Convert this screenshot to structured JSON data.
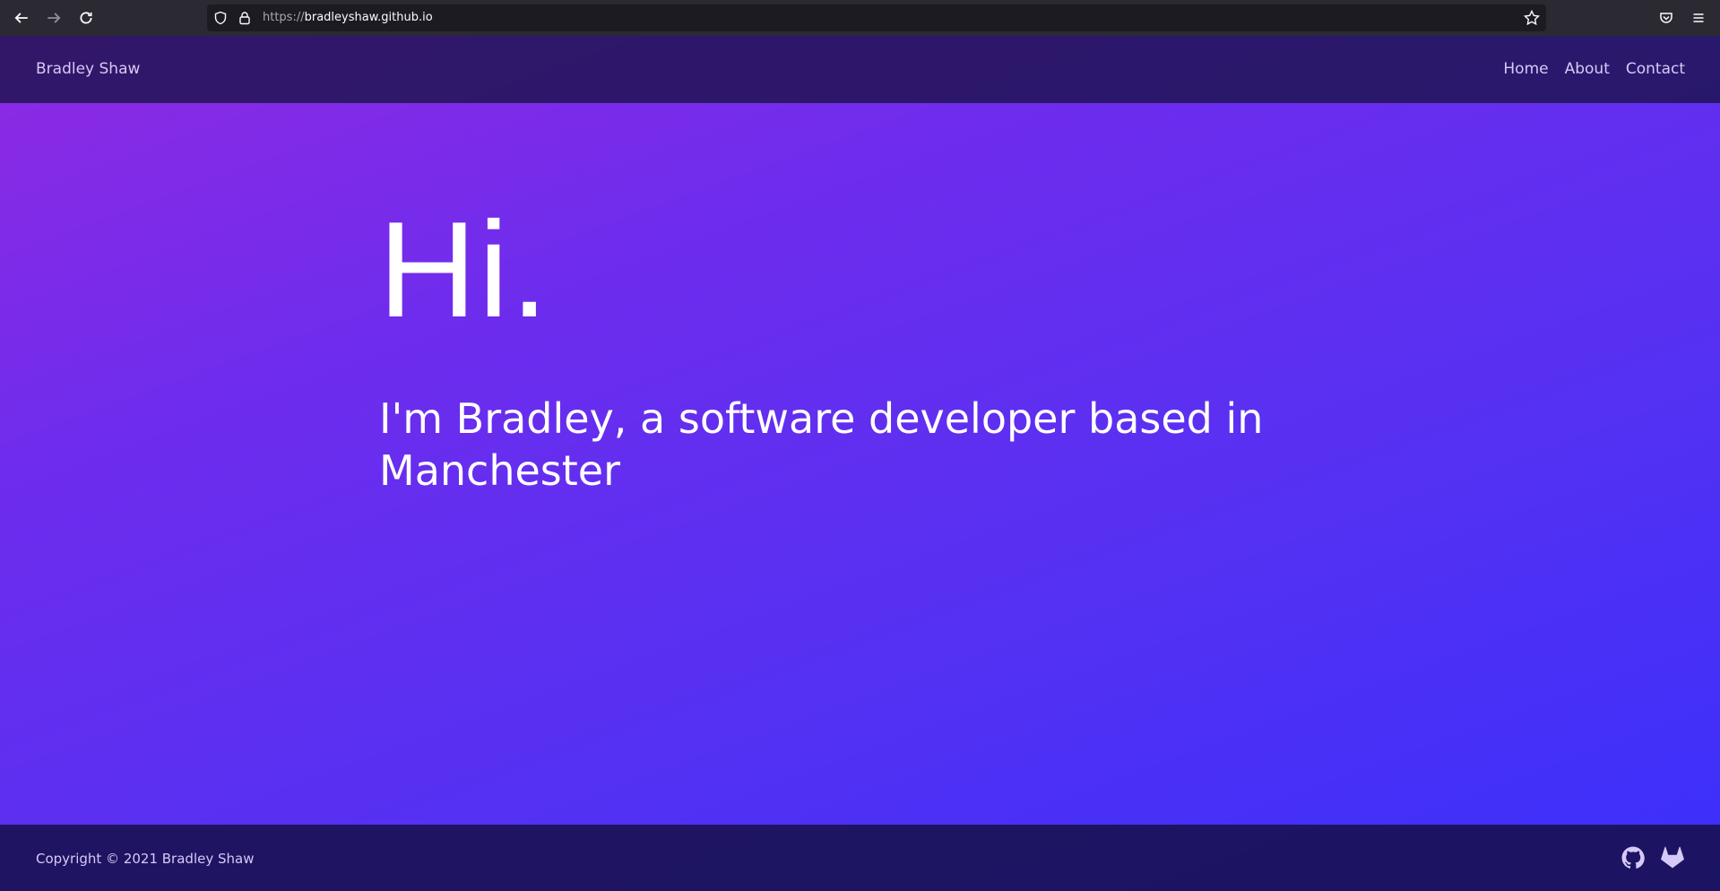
{
  "browser": {
    "url_protocol": "https://",
    "url_host": "bradleyshaw.github.io",
    "back_icon": "back-arrow-icon",
    "forward_icon": "forward-arrow-icon",
    "reload_icon": "reload-icon",
    "shield_icon": "tracking-shield-icon",
    "lock_icon": "lock-icon",
    "bookmark_icon": "star-icon",
    "pocket_icon": "pocket-icon",
    "menu_icon": "hamburger-menu-icon"
  },
  "navbar": {
    "brand": "Bradley Shaw",
    "links": [
      {
        "label": "Home"
      },
      {
        "label": "About"
      },
      {
        "label": "Contact"
      }
    ]
  },
  "hero": {
    "title": "Hi.",
    "subtitle": "I'm Bradley, a software developer based in Manchester"
  },
  "footer": {
    "copyright": "Copyright © 2021 Bradley Shaw",
    "icons": [
      "github-icon",
      "gitlab-icon"
    ]
  },
  "colors": {
    "gradient_start": "#8f2ae2",
    "gradient_end": "#3a2ffb",
    "navbar_bg": "#1e1450",
    "nav_text": "#d7c9f7",
    "hero_text": "#ffffff",
    "browser_chrome": "#2b2a33"
  }
}
